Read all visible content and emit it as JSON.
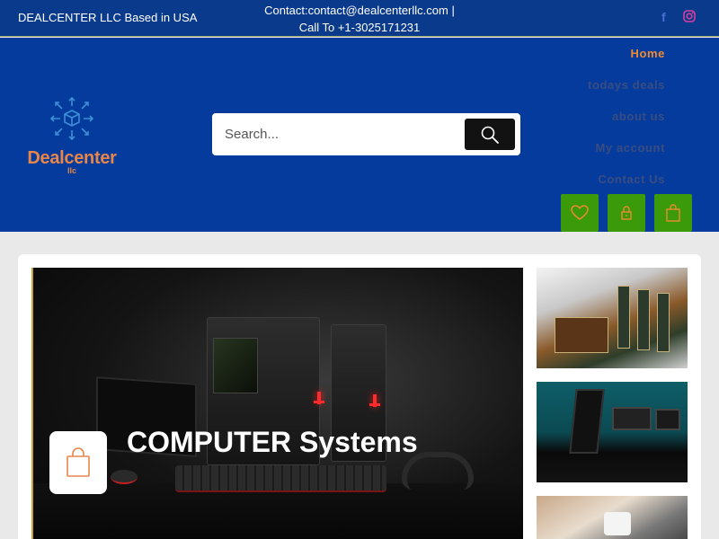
{
  "topbar": {
    "left_text": "DEALCENTER LLC Based in USA",
    "contact_line1": "Contact:contact@dealcenterllc.com |",
    "contact_line2": "Call To +1-3025171231",
    "social": [
      {
        "icon": "facebook-icon",
        "glyph": "f",
        "color": "#4a6fd8"
      },
      {
        "icon": "instagram-icon",
        "color": "#d63ea0"
      }
    ]
  },
  "logo": {
    "name": "Dealcenter",
    "sub": "llc"
  },
  "search": {
    "placeholder": "Search...",
    "icon": "search-icon"
  },
  "nav": {
    "items": [
      {
        "label": "Home",
        "active": true
      },
      {
        "label": "todays deals",
        "active": false
      },
      {
        "label": "about us",
        "active": false
      },
      {
        "label": "My account",
        "active": false
      },
      {
        "label": "Contact Us",
        "active": false
      }
    ]
  },
  "header_buttons": [
    {
      "icon": "heart-icon"
    },
    {
      "icon": "lock-icon"
    },
    {
      "icon": "shopping-bag-icon"
    }
  ],
  "hero": {
    "title": "COMPUTER Systems",
    "icon": "shopping-bag-icon"
  },
  "colors": {
    "topbar_bg": "#0a3a8c",
    "header_bg": "#053b9c",
    "accent_orange": "#ee8a33",
    "button_green": "#3a9a09",
    "page_bg": "#e9e9e9"
  }
}
